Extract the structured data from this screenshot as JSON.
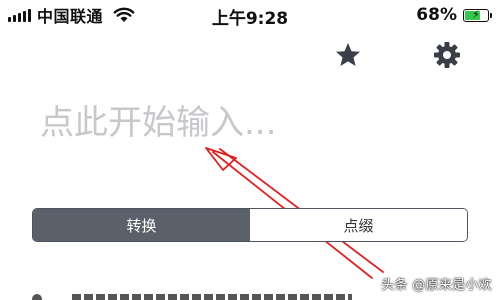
{
  "status_bar": {
    "carrier": "中国联通",
    "time": "上午9:28",
    "battery_percent": "68%",
    "battery_level": 0.68,
    "battery_color": "#35c84b",
    "signal_icon": "signal-bars-icon",
    "wifi_icon": "wifi-icon",
    "charging_icon": "charging-bolt-icon"
  },
  "toolbar": {
    "favorite_icon": "star-icon",
    "settings_icon": "gear-icon"
  },
  "input": {
    "placeholder": "点此开始输入...",
    "value": ""
  },
  "segmented": {
    "options": [
      {
        "label": "转换",
        "selected": true
      },
      {
        "label": "点缀",
        "selected": false
      }
    ],
    "active_color": "#5b616b"
  },
  "annotation": {
    "arrow_color": "#e02020"
  },
  "watermark": {
    "text": "头条 @原来是小欢"
  }
}
